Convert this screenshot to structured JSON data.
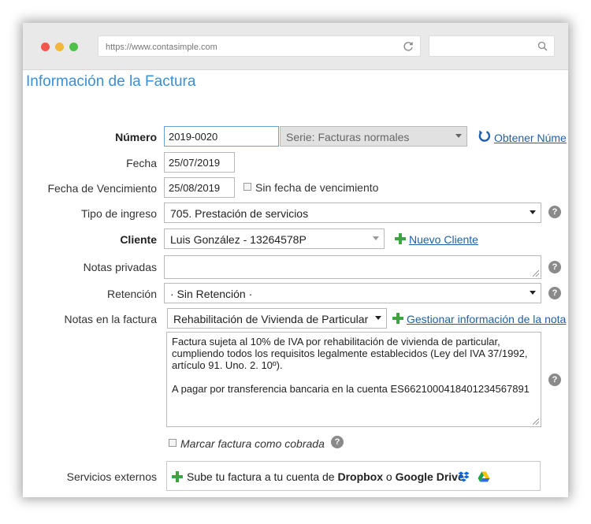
{
  "browser": {
    "url": "https://www.contasimple.com"
  },
  "page_title": "Información de la Factura",
  "form": {
    "numero": {
      "label": "Número",
      "value": "2019-0020",
      "serie": "Serie: Facturas normales",
      "link": "Obtener Núme"
    },
    "fecha": {
      "label": "Fecha",
      "value": "25/07/2019"
    },
    "vencimiento": {
      "label": "Fecha de Vencimiento",
      "value": "25/08/2019",
      "checkbox_label": "Sin fecha de vencimiento"
    },
    "tipo_ingreso": {
      "label": "Tipo de ingreso",
      "value": "705. Prestación de servicios"
    },
    "cliente": {
      "label": "Cliente",
      "value": "Luis González - 13264578P",
      "link": "Nuevo Cliente"
    },
    "notas_privadas": {
      "label": "Notas privadas",
      "value": ""
    },
    "retencion": {
      "label": "Retención",
      "value": "· Sin Retención ·"
    },
    "notas_factura": {
      "label": "Notas en la factura",
      "select_value": "Rehabilitación de Vivienda de Particular",
      "link": "Gestionar información de la nota",
      "lines": [
        "Factura sujeta al 10% de IVA por rehabilitación de vivienda de particular,",
        "cumpliendo todos los requisitos legalmente establecidos (Ley del IVA 37/1992,",
        "artículo 91. Uno. 2. 10º).",
        "",
        "A pagar por transferencia bancaria en la cuenta ES6621000418401234567891"
      ]
    },
    "cobrada": {
      "label": "Marcar factura como cobrada"
    },
    "servicios": {
      "label": "Servicios externos",
      "text_prefix": "Sube tu factura a tu cuenta de ",
      "dropbox": "Dropbox",
      "separator": " o ",
      "gdrive": "Google Drive"
    },
    "help_glyph": "?"
  },
  "icons": {
    "dropbox": "dropbox-icon",
    "gdrive": "google-drive-icon",
    "refresh": "refresh-icon"
  },
  "colors": {
    "title": "#3a8fd9",
    "link": "#1f5fa8",
    "plus": "#3ea341",
    "dropbox": "#0d63d9"
  }
}
